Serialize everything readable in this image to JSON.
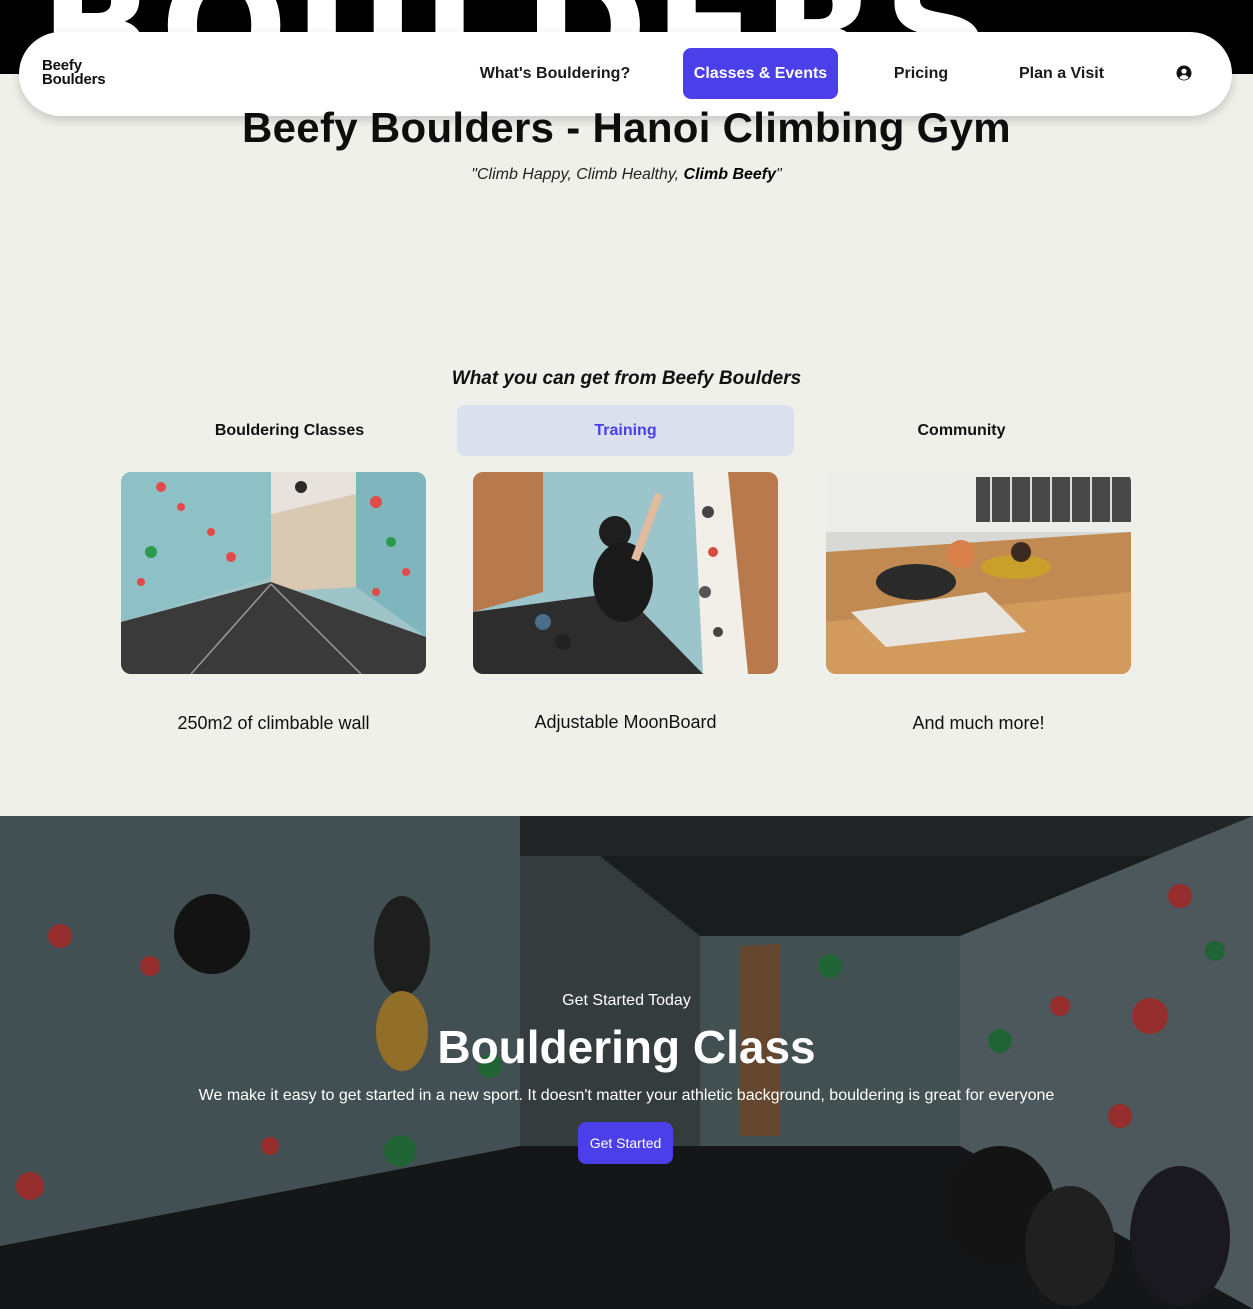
{
  "hero": {
    "background_text": "BOULDERS"
  },
  "nav": {
    "logo_line1": "Beefy",
    "logo_line2": "Boulders",
    "items": [
      {
        "label": "What's Bouldering?"
      },
      {
        "label": "Classes & Events",
        "active": true
      },
      {
        "label": "Pricing"
      },
      {
        "label": "Plan a Visit"
      }
    ],
    "account_icon": "user-circle-icon"
  },
  "main": {
    "title": "Beefy Boulders - Hanoi Climbing Gym",
    "tagline_open": "\"Climb Happy, Climb Healthy, ",
    "tagline_bold": "Climb Beefy",
    "tagline_close": "\"",
    "section_heading": "What you can get from Beefy Boulders",
    "tabs": [
      {
        "label": "Bouldering Classes"
      },
      {
        "label": "Training",
        "active": true
      },
      {
        "label": "Community"
      }
    ],
    "cards": [
      {
        "caption": "250m2 of climbable wall"
      },
      {
        "caption": "Adjustable MoonBoard"
      },
      {
        "caption": "And much more!"
      }
    ]
  },
  "cta": {
    "eyebrow": "Get Started Today",
    "title": "Bouldering Class",
    "text": "We make it easy to get started in a new sport. It doesn't matter your athletic background, bouldering is great for everyone",
    "button_label": "Get Started"
  },
  "colors": {
    "accent": "#4a3fe8",
    "page_bg": "#f0f0eb",
    "active_tab_bg": "#dbe0ef"
  }
}
